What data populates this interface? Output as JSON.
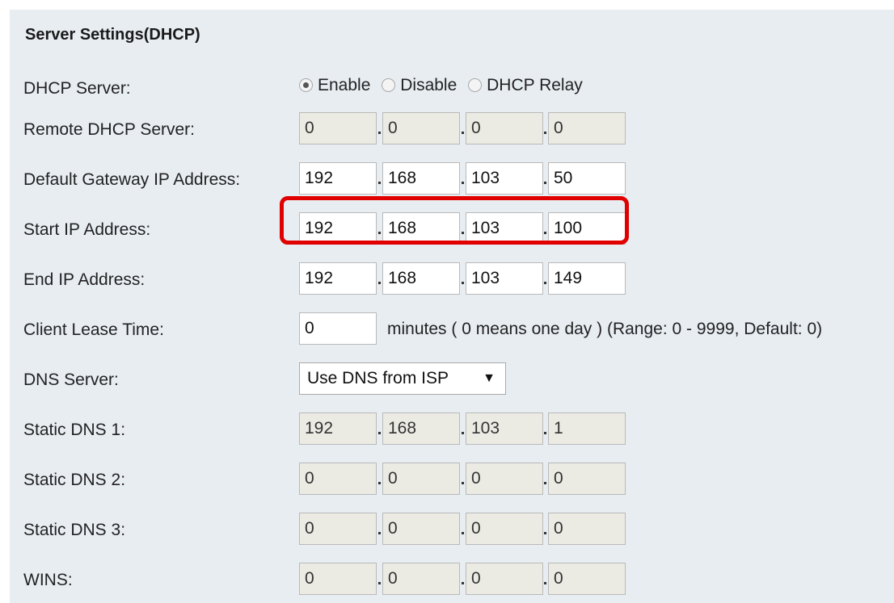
{
  "section_title": "Server Settings(DHCP)",
  "dhcp_server": {
    "label": "DHCP Server:",
    "options": [
      "Enable",
      "Disable",
      "DHCP Relay"
    ],
    "selected": "Enable"
  },
  "remote_dhcp": {
    "label": "Remote DHCP Server:",
    "octets": [
      "0",
      "0",
      "0",
      "0"
    ],
    "disabled": true
  },
  "default_gateway": {
    "label": "Default Gateway IP Address:",
    "octets": [
      "192",
      "168",
      "103",
      "50"
    ],
    "disabled": false
  },
  "start_ip": {
    "label": "Start IP Address:",
    "octets": [
      "192",
      "168",
      "103",
      "100"
    ],
    "disabled": false
  },
  "end_ip": {
    "label": "End IP Address:",
    "octets": [
      "192",
      "168",
      "103",
      "149"
    ],
    "disabled": false
  },
  "lease": {
    "label": "Client Lease Time:",
    "value": "0",
    "hint": "minutes ( 0 means one day )  (Range: 0 - 9999, Default: 0)"
  },
  "dns_server": {
    "label": "DNS Server:",
    "selected": "Use DNS from ISP",
    "arrow_icon": "▼"
  },
  "static_dns1": {
    "label": "Static DNS 1:",
    "octets": [
      "192",
      "168",
      "103",
      "1"
    ],
    "disabled": true
  },
  "static_dns2": {
    "label": "Static DNS 2:",
    "octets": [
      "0",
      "0",
      "0",
      "0"
    ],
    "disabled": true
  },
  "static_dns3": {
    "label": "Static DNS 3:",
    "octets": [
      "0",
      "0",
      "0",
      "0"
    ],
    "disabled": true
  },
  "wins": {
    "label": "WINS:",
    "octets": [
      "0",
      "0",
      "0",
      "0"
    ],
    "disabled": true
  },
  "highlight_color": "#e00000"
}
